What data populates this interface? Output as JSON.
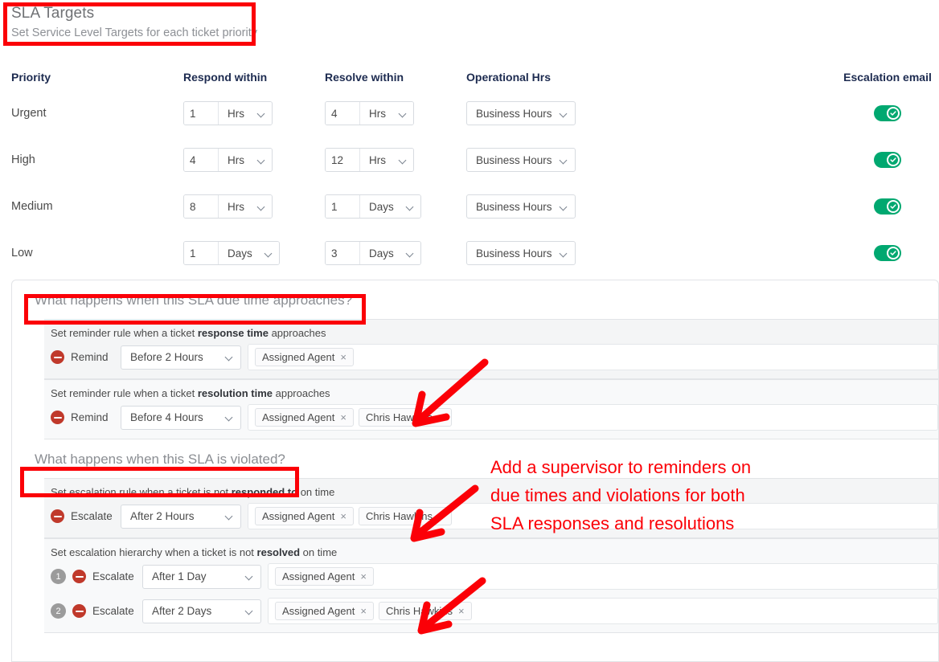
{
  "header": {
    "title": "SLA Targets",
    "subtitle": "Set Service Level Targets for each ticket priority"
  },
  "targets_table": {
    "columns": [
      "Priority",
      "Respond within",
      "Resolve within",
      "Operational Hrs",
      "Escalation email"
    ],
    "rows": [
      {
        "priority": "Urgent",
        "respond_value": "1",
        "respond_unit": "Hrs",
        "resolve_value": "4",
        "resolve_unit": "Hrs",
        "operational_hours": "Business Hours",
        "escalation_email": "on"
      },
      {
        "priority": "High",
        "respond_value": "4",
        "respond_unit": "Hrs",
        "resolve_value": "12",
        "resolve_unit": "Hrs",
        "operational_hours": "Business Hours",
        "escalation_email": "on"
      },
      {
        "priority": "Medium",
        "respond_value": "8",
        "respond_unit": "Hrs",
        "resolve_value": "1",
        "resolve_unit": "Days",
        "operational_hours": "Business Hours",
        "escalation_email": "on"
      },
      {
        "priority": "Low",
        "respond_value": "1",
        "respond_unit": "Days",
        "resolve_value": "3",
        "resolve_unit": "Days",
        "operational_hours": "Business Hours",
        "escalation_email": "on"
      }
    ]
  },
  "approaching_section": {
    "title": "What happens when this SLA due time approaches?",
    "response_rule": {
      "label_prefix": "Set reminder rule when a ticket ",
      "label_bold": "response time",
      "label_suffix": " approaches",
      "verb": "Remind",
      "timing": "Before 2 Hours",
      "recipients": [
        "Assigned Agent"
      ]
    },
    "resolution_rule": {
      "label_prefix": "Set reminder rule when a ticket ",
      "label_bold": "resolution time",
      "label_suffix": " approaches",
      "verb": "Remind",
      "timing": "Before 4 Hours",
      "recipients": [
        "Assigned Agent",
        "Chris Hawkins"
      ]
    }
  },
  "violated_section": {
    "title": "What happens when this SLA is violated?",
    "response_rule": {
      "label_prefix": "Set escalation rule when a ticket is not ",
      "label_bold": "responded to",
      "label_suffix": " on time",
      "verb": "Escalate",
      "timing": "After 2 Hours",
      "recipients": [
        "Assigned Agent",
        "Chris Hawkins"
      ]
    },
    "resolution_hierarchy": {
      "label_prefix": "Set escalation hierarchy when a ticket is not ",
      "label_bold": "resolved",
      "label_suffix": " on time",
      "levels": [
        {
          "number": "1",
          "verb": "Escalate",
          "timing": "After 1 Day",
          "recipients": [
            "Assigned Agent"
          ]
        },
        {
          "number": "2",
          "verb": "Escalate",
          "timing": "After 2 Days",
          "recipients": [
            "Assigned Agent",
            "Chris Hawkins"
          ]
        }
      ]
    }
  },
  "annotation": {
    "note": "Add a supervisor to reminders on\ndue times and violations for both\nSLA responses and resolutions",
    "color": "#fb0007"
  },
  "tag_remove_glyph": "×"
}
